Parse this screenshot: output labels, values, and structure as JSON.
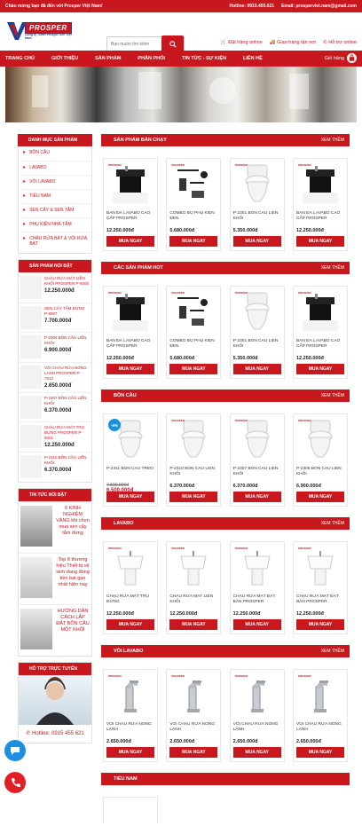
{
  "topbar": {
    "welcome": "Chào mừng bạn đã đến với Prosper Việt Nam!",
    "hotline": "Hotline: 0915.455.621",
    "email": "Email: prosperviet.nam@gmail.com"
  },
  "header": {
    "logo_text": "PROSPER",
    "logo_sub": "Công ty TNHH Prosper Sen Việt Nam",
    "search_placeholder": "Bạn muốn tìm kiếm",
    "links": [
      "Đặt hàng online",
      "Giao hàng tận nơi",
      "Hỗ trợ online"
    ]
  },
  "nav": {
    "items": [
      "TRANG CHỦ",
      "GIỚI THIỆU",
      "SẢN PHẨM",
      "PHÂN PHỐI",
      "TIN TỨC - SỰ KIỆN",
      "LIÊN HỆ"
    ],
    "cart": "Giỏ hàng"
  },
  "sidebar": {
    "categories_title": "DANH MỤC SẢN PHẨM",
    "categories": [
      "BỒN CẦU",
      "LAVABO",
      "VÒI LAVABO",
      "TIỂU NAM",
      "SEN CÂY & SEN TẮM",
      "PHỤ KIỆN NHÀ TẮM",
      "CHẬU RỬA BÁT & VÒI RỬA BÁT"
    ],
    "featured_title": "SẢN PHẨM NỔI BẬT",
    "featured": [
      {
        "name": "CHẬU RỬA MẶT LIỀN KHỐI PROSPER P-5005",
        "price": "12.250.000đ"
      },
      {
        "name": "SEN CÂY TẮM ĐỨNG P-8007",
        "price": "7.700.000đ"
      },
      {
        "name": "P-2306 BỒN CẦU LIỀN KHỐI",
        "price": "6.900.000đ"
      },
      {
        "name": "VÒI CHẬU RỬA NÓNG LẠNH PROSPER P-7012",
        "price": "2.650.000đ"
      },
      {
        "name": "P-2307 BỒN CẦU LIỀN KHỐI",
        "price": "6.370.000đ"
      },
      {
        "name": "CHẬU RỬA MẶT TRỤ ĐỨNG PROSPER P-5001",
        "price": "12.250.000đ"
      },
      {
        "name": "P-2310 BỒN CẦU LIỀN KHỐI",
        "price": "6.370.000đ"
      }
    ],
    "news_title": "TIN TỨC NỔI BẬT",
    "news": [
      "6 KINH NGHIỆM VÀNG khi chọn mua sen cây tắm đứng",
      "Top 8 thương hiệu Thiết bị vệ sinh đang đóng tiền bạt gạo nhất hiện nay",
      "HƯỚNG DẪN CÁCH LẮP ĐẶT BỒN CẦU MỘT KHỐI"
    ],
    "support_title": "HỖ TRỢ TRỰC TUYẾN",
    "support_hotline": "Hotline: 0915 455 621"
  },
  "sections": [
    {
      "title": "SẢN PHẨM BÁN CHẠY",
      "more": "XEM THÊM",
      "products": [
        {
          "name": "BÀN ĐÁ LAVABO CAO CẤP PROSPER",
          "price": "12.250.000đ",
          "img": "vanity-icon"
        },
        {
          "name": "COMBO BỘ PHỤ KIỆN ĐEN",
          "price": "5.680.000đ",
          "img": "accessory-icon"
        },
        {
          "name": "P-2301 BỒN CẦU LIỀN KHỐI",
          "price": "5.350.000đ",
          "img": "toilet-icon"
        },
        {
          "name": "BÀN ĐÁ LAVABO CAO CẤP PROSPER",
          "price": "12.250.000đ",
          "img": "vanity-icon"
        }
      ]
    },
    {
      "title": "CÁC SẢN PHẨM HOT",
      "more": "XEM THÊM",
      "products": [
        {
          "name": "BÀN ĐÁ LAVABO CAO CẤP PROSPER",
          "price": "12.250.000đ",
          "img": "vanity-icon"
        },
        {
          "name": "COMBO BỘ PHỤ KIỆN ĐEN",
          "price": "5.680.000đ",
          "img": "accessory-icon"
        },
        {
          "name": "P-2301 BỒN CẦU LIỀN KHỐI",
          "price": "5.350.000đ",
          "img": "toilet-icon"
        },
        {
          "name": "BÀN ĐÁ LAVABO CAO CẤP PROSPER",
          "price": "12.250.000đ",
          "img": "vanity-icon"
        }
      ]
    },
    {
      "title": "BỒN CẦU",
      "more": "XEM THÊM",
      "products": [
        {
          "name": "P-2311 BỒN CẦU TREO",
          "price": "6.500.000đ",
          "old_price": "7.500.000đ",
          "discount": "-6%",
          "img": "toilet-icon"
        },
        {
          "name": "P-2310 BỒN CẦU LIỀN KHỐI",
          "price": "6.370.000đ",
          "img": "toilet-icon"
        },
        {
          "name": "P-2307 BỒN CẦU LIỀN KHỐI",
          "price": "6.370.000đ",
          "img": "toilet-icon"
        },
        {
          "name": "P-2306 BỒN CẦU LIỀN KHỐI",
          "price": "6.900.000đ",
          "img": "toilet-icon"
        }
      ]
    },
    {
      "title": "LAVABO",
      "more": "XEM THÊM",
      "products": [
        {
          "name": "CHẬU RỬA MẶT TRỤ ĐỨNG",
          "price": "12.250.000đ",
          "img": "basin-icon"
        },
        {
          "name": "CHẬU RỬA MẶT LIỀN KHỐI",
          "price": "12.250.000đ",
          "img": "basin-icon"
        },
        {
          "name": "CHẬU RỬA MẶT ĐẶT BÀN PROSPER",
          "price": "12.250.000đ",
          "img": "basin-icon"
        },
        {
          "name": "CHẬU RỬA MẶT ĐẶT BÀN PROSPER",
          "price": "12.250.000đ",
          "img": "basin-icon"
        }
      ]
    },
    {
      "title": "VÒI LAVABO",
      "more": "XEM THÊM",
      "products": [
        {
          "name": "VÒI CHẬU RỬA NÓNG LẠNH",
          "price": "2.650.000đ",
          "img": "faucet-icon"
        },
        {
          "name": "VÒI CHẬU RỬA NÓNG LẠNH",
          "price": "2.650.000đ",
          "img": "faucet-icon"
        },
        {
          "name": "VÒI CHẬU RỬA NÓNG LẠNH",
          "price": "2.650.000đ",
          "img": "faucet-icon"
        },
        {
          "name": "VÒI CHẬU RỬA NÓNG LẠNH",
          "price": "2.650.000đ",
          "img": "faucet-icon"
        }
      ]
    },
    {
      "title": "TIỂU NAM",
      "more": "",
      "products": []
    }
  ],
  "product_cta": "MUA NGAY",
  "colors": {
    "brand_red": "#c8171e",
    "brand_blue": "#1b3f95"
  }
}
